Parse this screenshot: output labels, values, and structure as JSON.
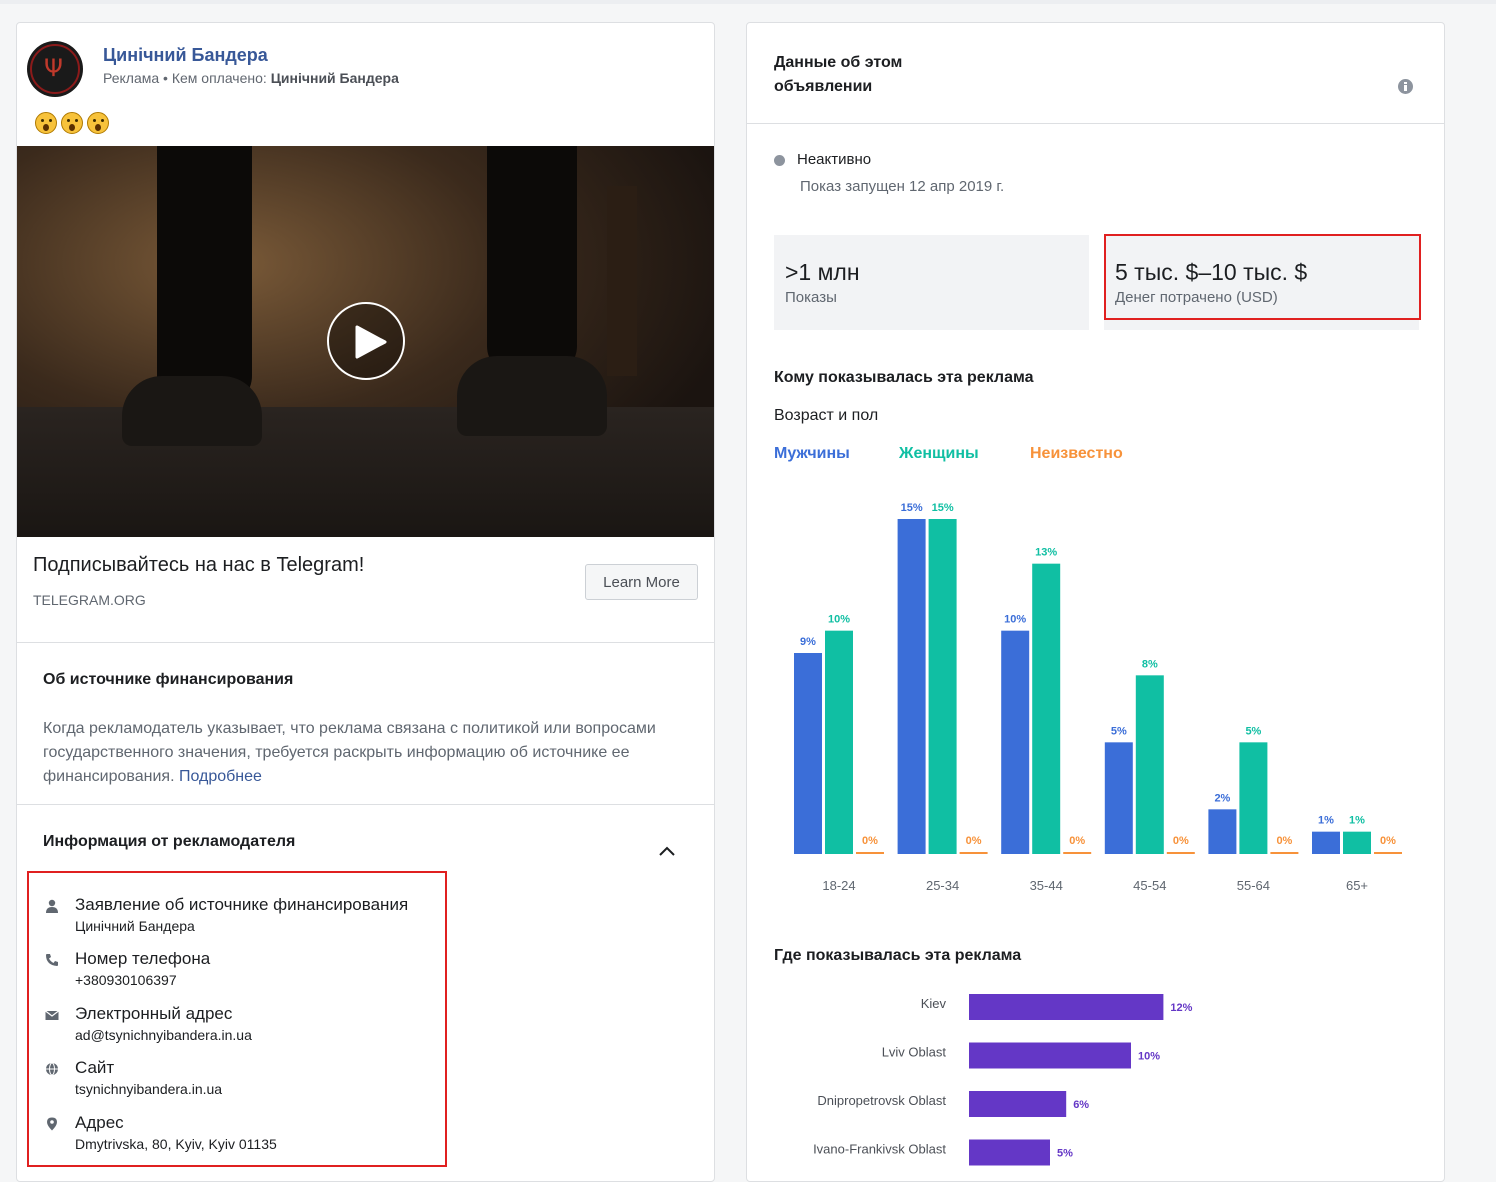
{
  "ad": {
    "page_name": "Цинічний Бандера",
    "sponsor_prefix": "Реклама • Кем оплачено: ",
    "sponsor_name": "Цинічний Бандера",
    "video_label": "play",
    "cta_title": "Подписывайтесь на нас в Telegram!",
    "cta_domain": "TELEGRAM.ORG",
    "cta_button": "Learn More"
  },
  "funding": {
    "title": "Об источнике финансирования",
    "text": "Когда рекламодатель указывает, что реклама связана с политикой или вопросами государственного значения, требуется раскрыть информацию об источнике ее финансирования. ",
    "link": "Подробнее"
  },
  "advertiser": {
    "title": "Информация от рекламодателя",
    "items": [
      {
        "icon": "person-icon",
        "label": "Заявление об источнике финансирования",
        "value": "Цинічний Бандера"
      },
      {
        "icon": "phone-icon",
        "label": "Номер телефона",
        "value": "+380930106397"
      },
      {
        "icon": "envelope-icon",
        "label": "Электронный адрес",
        "value": "ad@tsynichnyibandera.in.ua"
      },
      {
        "icon": "globe-icon",
        "label": "Сайт",
        "value": "tsynichnyibandera.in.ua"
      },
      {
        "icon": "location-pin-icon",
        "label": "Адрес",
        "value": "Dmytrivska, 80, Kyiv, Kyiv 01135"
      }
    ]
  },
  "details": {
    "title": "Данные об этом объявлении",
    "status": "Неактивно",
    "launched": "Показ запущен 12 апр 2019 г.",
    "impressions_value": ">1 млн",
    "impressions_label": "Показы",
    "spend_value": "5 тыс. $–10 тыс. $",
    "spend_label": "Денег потрачено (USD)"
  },
  "audience": {
    "title": "Кому показывалась эта реклама",
    "subtitle": "Возраст и пол",
    "legend_male": "Мужчины",
    "legend_female": "Женщины",
    "legend_unknown": "Неизвестно"
  },
  "region": {
    "title": "Где показывалась эта реклама"
  },
  "colors": {
    "male": "#3b6ed8",
    "female": "#10bfa3",
    "unknown": "#f7923a",
    "region": "#6437c6",
    "link": "#385898",
    "highlight": "#e02020"
  },
  "chart_data": [
    {
      "type": "bar",
      "categories": [
        "18-24",
        "25-34",
        "35-44",
        "45-54",
        "55-64",
        "65+"
      ],
      "series": [
        {
          "name": "Мужчины",
          "values": [
            9,
            15,
            10,
            5,
            2,
            1
          ],
          "labels": [
            "9%",
            "15%",
            "10%",
            "5%",
            "2%",
            "1%"
          ]
        },
        {
          "name": "Женщины",
          "values": [
            10,
            15,
            13,
            8,
            5,
            1
          ],
          "labels": [
            "10%",
            "15%",
            "13%",
            "8%",
            "5%",
            "1%"
          ]
        },
        {
          "name": "Неизвестно",
          "values": [
            0,
            0,
            0,
            0,
            0,
            0
          ],
          "labels": [
            "0%",
            "0%",
            "0%",
            "0%",
            "0%",
            "0%"
          ]
        }
      ],
      "ylim": [
        0,
        15
      ]
    },
    {
      "type": "bar",
      "orientation": "horizontal",
      "categories": [
        "Kiev",
        "Lviv Oblast",
        "Dnipropetrovsk Oblast",
        "Ivano-Frankivsk Oblast"
      ],
      "values": [
        12,
        10,
        6,
        5
      ],
      "labels": [
        "12%",
        "10%",
        "6%",
        "5%"
      ]
    }
  ]
}
